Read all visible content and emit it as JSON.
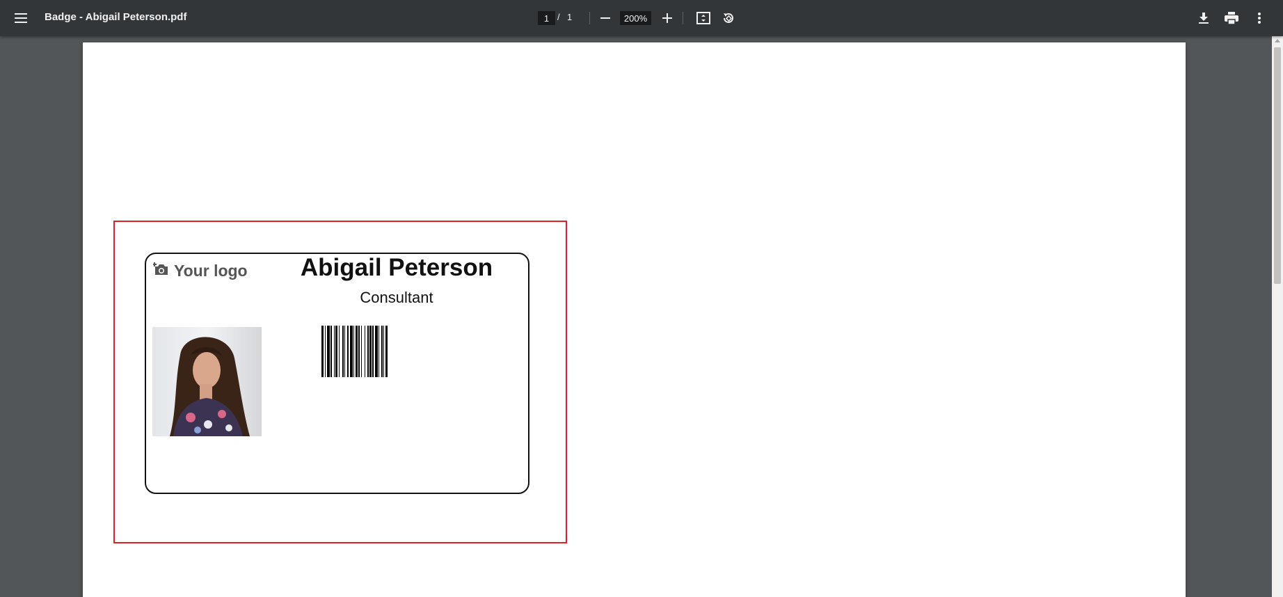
{
  "toolbar": {
    "menu_icon": "hamburger-menu-icon",
    "title": "Badge - Abigail Peterson.pdf",
    "page_current": "1",
    "page_separator": "/",
    "page_total": "1",
    "zoom_out_icon": "minus-icon",
    "zoom_value": "200%",
    "zoom_in_icon": "plus-icon",
    "fit_page_icon": "fit-to-page-icon",
    "rotate_icon": "rotate-counterclockwise-icon",
    "download_icon": "download-icon",
    "print_icon": "print-icon",
    "more_icon": "more-vertical-icon"
  },
  "badge": {
    "logo_text": "Your logo",
    "logo_icon": "camera-add-icon",
    "name": "Abigail Peterson",
    "role": "Consultant",
    "photo": "portrait-photo",
    "barcode": "barcode",
    "frame_color": "#e02020"
  },
  "colors": {
    "toolbar_bg": "#323639",
    "viewer_bg": "#525659",
    "page_bg": "#ffffff"
  }
}
